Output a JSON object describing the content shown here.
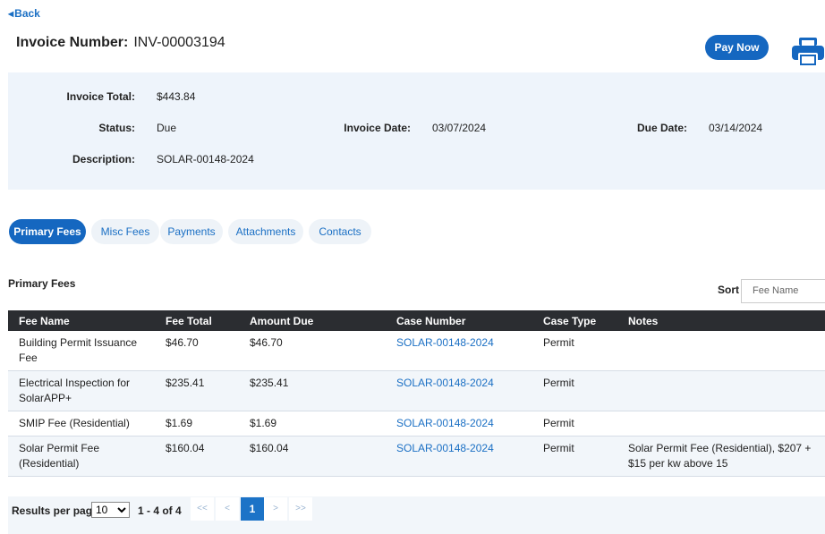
{
  "nav": {
    "back_label": "Back"
  },
  "header": {
    "invoice_label": "Invoice Number:",
    "invoice_number": "INV-00003194",
    "pay_now_label": "Pay Now",
    "print_icon": "print-icon"
  },
  "summary": {
    "total_label": "Invoice Total:",
    "total_value": "$443.84",
    "status_label": "Status:",
    "status_value": "Due",
    "invoice_date_label": "Invoice Date:",
    "invoice_date_value": "03/07/2024",
    "due_date_label": "Due Date:",
    "due_date_value": "03/14/2024",
    "description_label": "Description:",
    "description_value": "SOLAR-00148-2024"
  },
  "tabs": [
    {
      "label": "Primary Fees",
      "active": true
    },
    {
      "label": "Misc Fees",
      "active": false
    },
    {
      "label": "Payments",
      "active": false
    },
    {
      "label": "Attachments",
      "active": false
    },
    {
      "label": "Contacts",
      "active": false
    }
  ],
  "section": {
    "title": "Primary Fees",
    "sort_label": "Sort",
    "sort_placeholder": "Fee Name"
  },
  "table": {
    "columns": [
      "Fee Name",
      "Fee Total",
      "Amount Due",
      "Case Number",
      "Case Type",
      "Notes"
    ],
    "rows": [
      {
        "fee_name": "Building Permit Issuance Fee",
        "fee_total": "$46.70",
        "amount_due": "$46.70",
        "case_number": "SOLAR-00148-2024",
        "case_type": "Permit",
        "notes": ""
      },
      {
        "fee_name": "Electrical Inspection for SolarAPP+",
        "fee_total": "$235.41",
        "amount_due": "$235.41",
        "case_number": "SOLAR-00148-2024",
        "case_type": "Permit",
        "notes": ""
      },
      {
        "fee_name": "SMIP Fee (Residential)",
        "fee_total": "$1.69",
        "amount_due": "$1.69",
        "case_number": "SOLAR-00148-2024",
        "case_type": "Permit",
        "notes": ""
      },
      {
        "fee_name": "Solar Permit Fee (Residential)",
        "fee_total": "$160.04",
        "amount_due": "$160.04",
        "case_number": "SOLAR-00148-2024",
        "case_type": "Permit",
        "notes": "Solar Permit Fee (Residential), $207 + $15 per kw above 15"
      }
    ]
  },
  "pager": {
    "results_label": "Results per page",
    "per_page": "10",
    "range": "1 - 4 of 4",
    "first": "<<",
    "prev": "<",
    "current": "1",
    "next": ">",
    "last": ">>"
  },
  "colors": {
    "accent": "#1567c0",
    "link": "#1a6fc4",
    "panel": "#eef4fb",
    "header_row": "#2b2d31"
  }
}
